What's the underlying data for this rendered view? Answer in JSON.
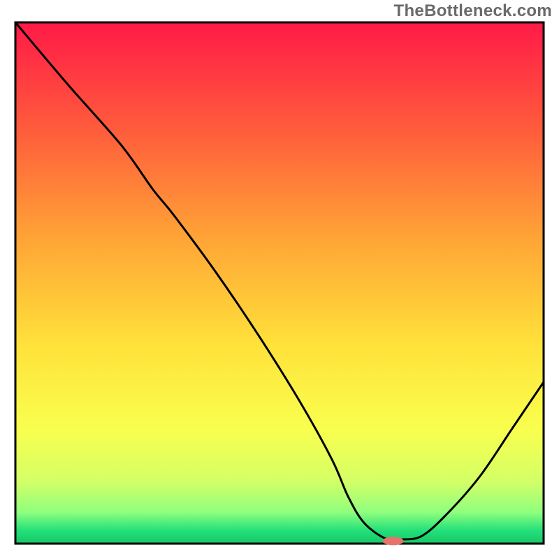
{
  "watermark": "TheBottleneck.com",
  "chart_data": {
    "type": "line",
    "title": "",
    "xlabel": "",
    "ylabel": "",
    "xlim": [
      0,
      100
    ],
    "ylim": [
      0,
      100
    ],
    "gradient_stops": [
      {
        "offset": 0.0,
        "color": "#ff1a47"
      },
      {
        "offset": 0.2,
        "color": "#ff5a3c"
      },
      {
        "offset": 0.42,
        "color": "#ffa636"
      },
      {
        "offset": 0.62,
        "color": "#ffe23a"
      },
      {
        "offset": 0.78,
        "color": "#f9ff4e"
      },
      {
        "offset": 0.88,
        "color": "#d4ff66"
      },
      {
        "offset": 0.94,
        "color": "#8fff7e"
      },
      {
        "offset": 0.975,
        "color": "#22e07a"
      },
      {
        "offset": 1.0,
        "color": "#17c765"
      }
    ],
    "series": [
      {
        "name": "bottleneck-curve",
        "x": [
          0.0,
          10.0,
          20.0,
          26.0,
          30.0,
          38.0,
          46.0,
          54.0,
          60.0,
          63.0,
          66.0,
          70.0,
          73.0,
          77.0,
          82.0,
          88.0,
          94.0,
          100.0
        ],
        "y": [
          100.0,
          88.0,
          76.5,
          68.0,
          63.0,
          52.0,
          40.0,
          27.0,
          16.0,
          9.0,
          4.0,
          1.0,
          0.8,
          1.5,
          6.0,
          13.0,
          22.0,
          31.0
        ]
      }
    ],
    "marker": {
      "name": "optimal-point",
      "x": 71.5,
      "y": 0.5,
      "color": "#e9716b",
      "rx": 15,
      "ry": 6
    }
  }
}
